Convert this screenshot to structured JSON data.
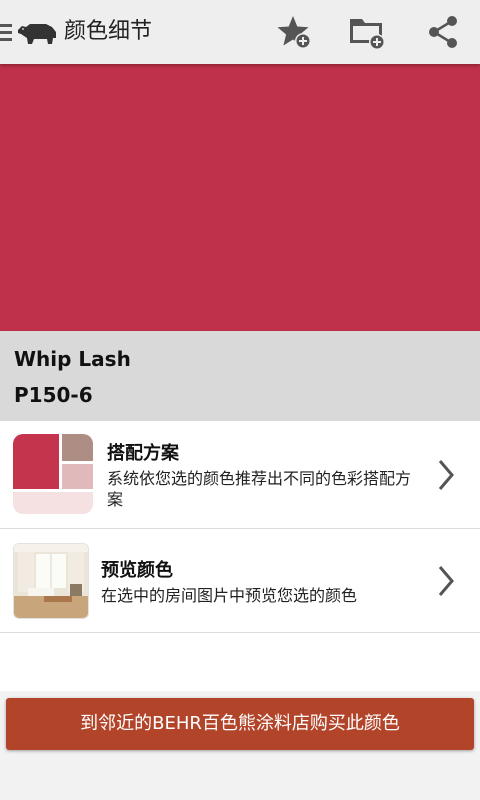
{
  "app": {
    "title": "颜色细节",
    "icons": [
      "menu-icon",
      "bear-logo-icon",
      "star-add-icon",
      "folder-add-icon",
      "share-icon"
    ]
  },
  "color": {
    "name": "Whip Lash",
    "code": "P150-6",
    "swatch_hex": "#bf314a"
  },
  "options": [
    {
      "title": "搭配方案",
      "description": "系统依您选的颜色推荐出不同的色彩搭配方案",
      "thumb_colors": [
        "#c5344d",
        "#ae8e84",
        "#e0b9ba",
        "#f5e1e2"
      ]
    },
    {
      "title": "预览颜色",
      "description": "在选中的房间图片中预览您选的颜色"
    }
  ],
  "buy_button": {
    "label": "到邻近的BEHR百色熊涂料店购买此颜色",
    "color": "#b2442a"
  }
}
